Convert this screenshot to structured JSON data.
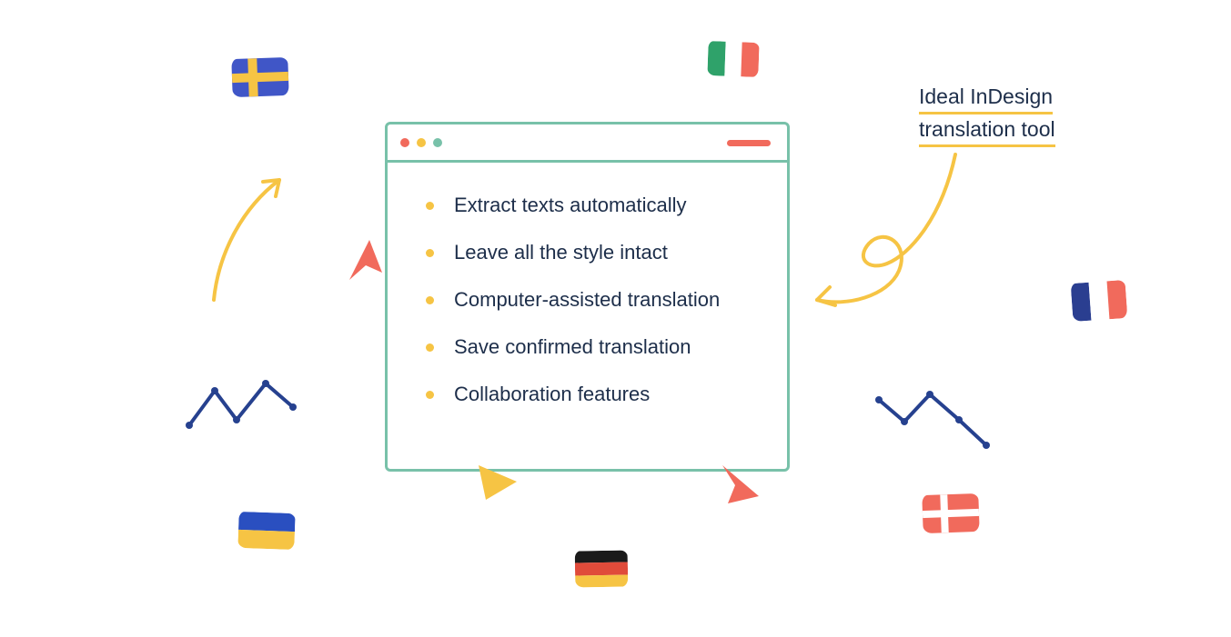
{
  "callout": {
    "line1": "Ideal InDesign",
    "line2": "translation tool"
  },
  "features": [
    "Extract texts automatically",
    "Leave all the style intact",
    "Computer-assisted translation",
    "Save confirmed translation",
    "Collaboration features"
  ],
  "flags": {
    "sweden": "sweden",
    "ireland": "ireland",
    "france": "france",
    "denmark": "denmark",
    "germany": "germany",
    "ukraine": "ukraine"
  },
  "colors": {
    "border_green": "#78c1a9",
    "accent_yellow": "#f6c444",
    "accent_red": "#f16a5c",
    "text": "#1d2e4a",
    "line_blue": "#26418f"
  }
}
